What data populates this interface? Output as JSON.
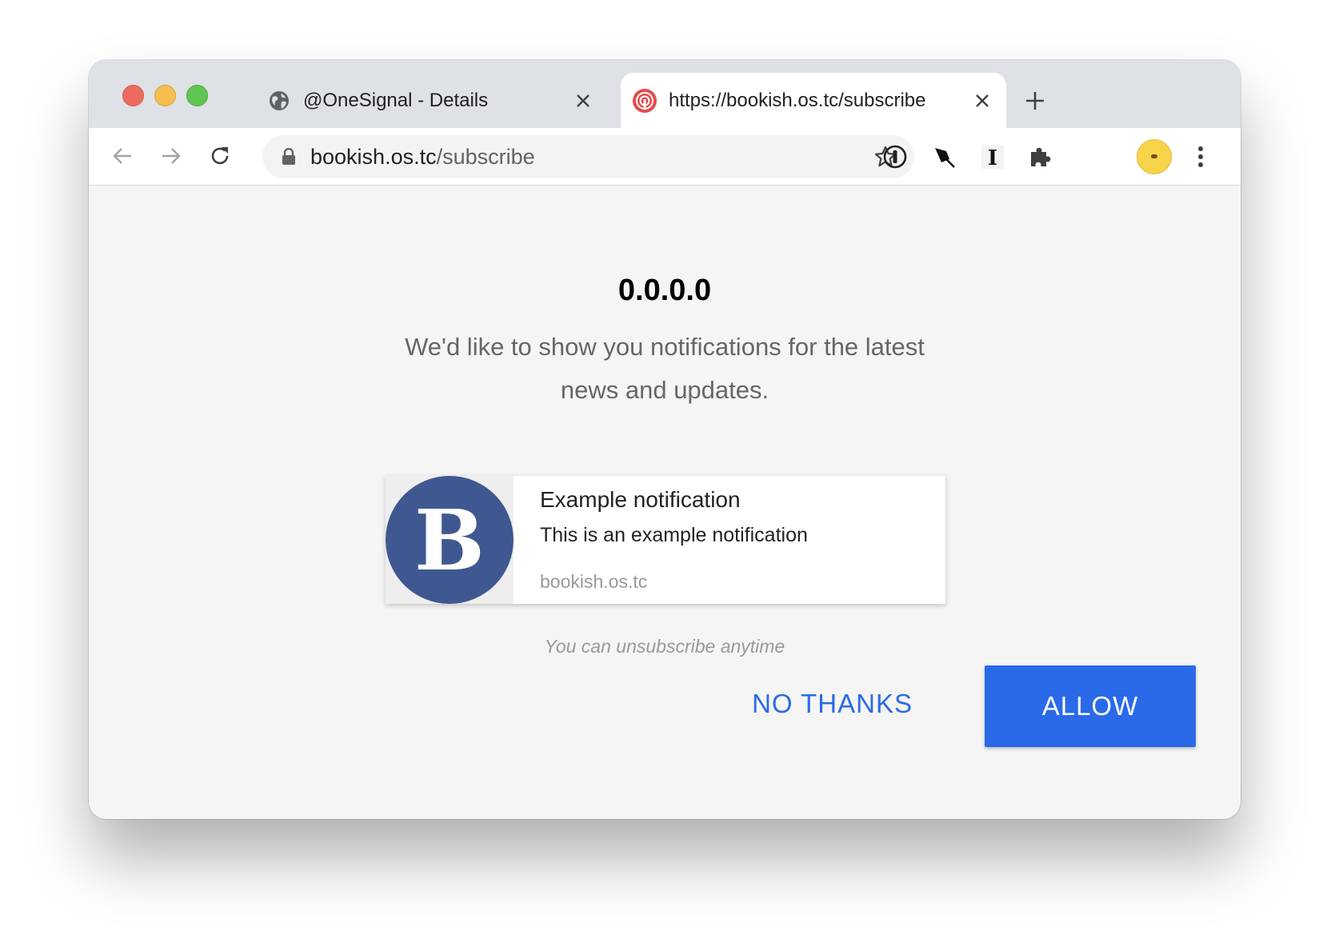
{
  "tabs": [
    {
      "title": "@OneSignal - Details",
      "favicon": "globe-icon",
      "active": false
    },
    {
      "title": "https://bookish.os.tc/subscribe",
      "favicon": "onesignal-icon",
      "active": true
    }
  ],
  "omnibox": {
    "host": "bookish.os.tc",
    "path": "/subscribe"
  },
  "page": {
    "heading": "0.0.0.0",
    "message": "We'd like to show you notifications for the latest news and updates.",
    "notification": {
      "logo_letter": "B",
      "title": "Example notification",
      "body": "This is an example notification",
      "site": "bookish.os.tc"
    },
    "fineprint": "You can unsubscribe anytime",
    "buttons": {
      "decline": "NO THANKS",
      "allow": "ALLOW"
    }
  },
  "colors": {
    "accent": "#2a6ae8",
    "logo_bg": "#405891",
    "page_bg": "#f5f5f5",
    "tabstrip_bg": "#dee1e6"
  },
  "extensions": {
    "password_label": "①",
    "reader_label": "I"
  }
}
